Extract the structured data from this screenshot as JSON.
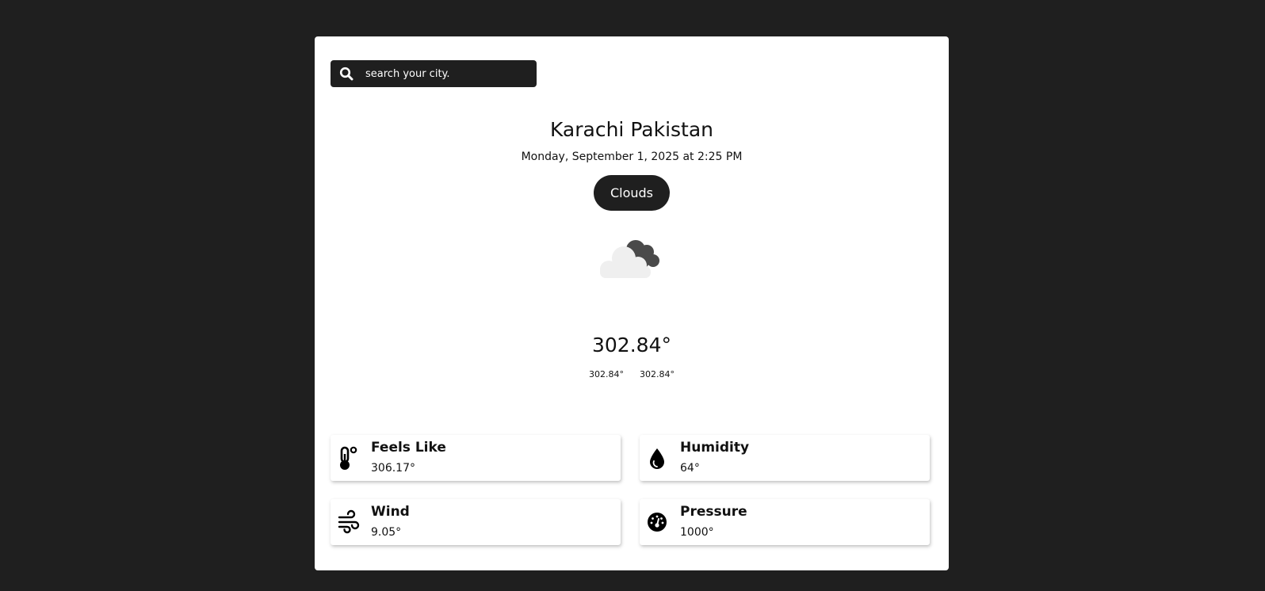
{
  "search": {
    "placeholder": "search your city.",
    "icon": "search-icon"
  },
  "location": {
    "city": "Karachi Pakistan",
    "datetime": "Monday, September 1, 2025 at 2:25 PM"
  },
  "condition": {
    "label": "Clouds",
    "icon": "cloud-icon"
  },
  "temperature": {
    "current": "302.84°",
    "min": "302.84°",
    "max": "302.84°"
  },
  "details": [
    {
      "label": "Feels Like",
      "value": "306.17°",
      "icon": "thermometer-icon"
    },
    {
      "label": "Humidity",
      "value": "64°",
      "icon": "droplet-icon"
    },
    {
      "label": "Wind",
      "value": "9.05°",
      "icon": "wind-icon"
    },
    {
      "label": "Pressure",
      "value": "1000°",
      "icon": "gauge-icon"
    }
  ],
  "colors": {
    "background": "#1f1f1f",
    "card": "#ffffff",
    "text": "#111111"
  }
}
